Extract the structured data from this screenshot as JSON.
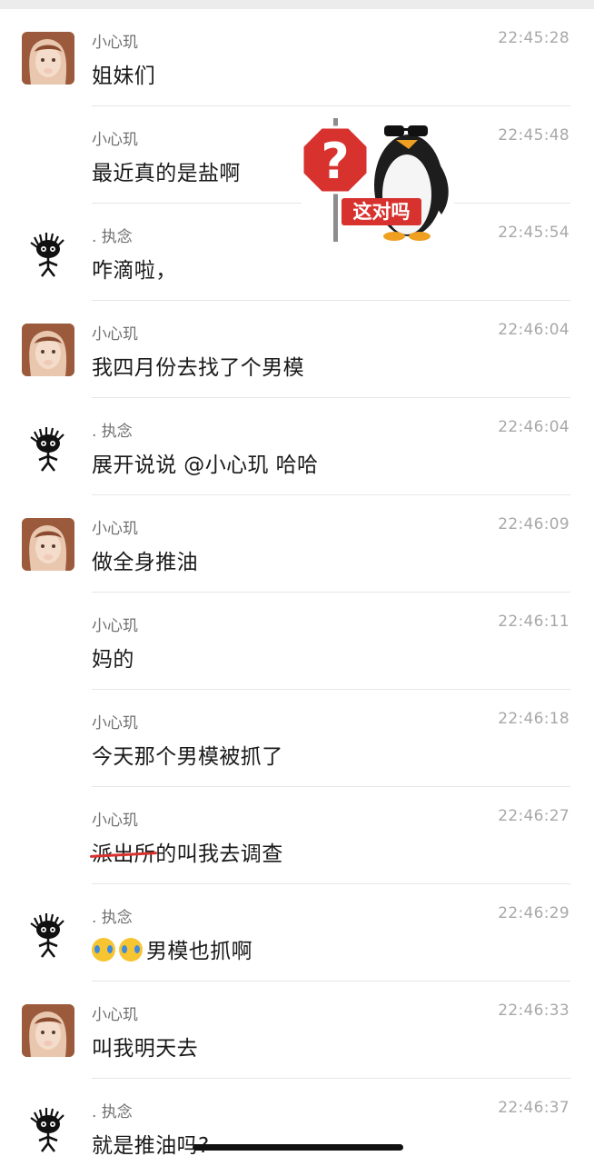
{
  "messages": [
    {
      "name": "小心玑",
      "time": "22:45:28",
      "text": "姐妹们",
      "avatar": "girl-avatar"
    },
    {
      "name": "小心玑",
      "time": "22:45:48",
      "text": "最近真的是盐啊",
      "avatar": ""
    },
    {
      "name": ". 执念",
      "time": "22:45:54",
      "text": "咋滴啦，",
      "avatar": "cartoon-avatar"
    },
    {
      "name": "小心玑",
      "time": "22:46:04",
      "text": "我四月份去找了个男模",
      "avatar": "girl-avatar"
    },
    {
      "name": ". 执念",
      "time": "22:46:04",
      "text": "展开说说 @小心玑  哈哈",
      "avatar": "cartoon-avatar"
    },
    {
      "name": "小心玑",
      "time": "22:46:09",
      "text": "做全身推油",
      "avatar": "girl-avatar"
    },
    {
      "name": "小心玑",
      "time": "22:46:11",
      "text": "妈的",
      "avatar": ""
    },
    {
      "name": "小心玑",
      "time": "22:46:18",
      "text": "今天那个男模被抓了",
      "avatar": ""
    },
    {
      "name": "小心玑",
      "time": "22:46:27",
      "text_struck": "派出所",
      "text": "的叫我去调查",
      "avatar": ""
    },
    {
      "name": ". 执念",
      "time": "22:46:29",
      "text": "男模也抓啊",
      "emoji": [
        "crying-laughing-emoji",
        "crying-laughing-emoji"
      ],
      "avatar": "cartoon-avatar"
    },
    {
      "name": "小心玑",
      "time": "22:46:33",
      "text": "叫我明天去",
      "avatar": "girl-avatar"
    },
    {
      "name": ". 执念",
      "time": "22:46:37",
      "text": "就是推油吗?",
      "avatar": "cartoon-avatar"
    }
  ],
  "sticker": {
    "sign_text": "这对吗",
    "icon": "penguin-question-sticker"
  },
  "colors": {
    "sign_red": "#d8322f",
    "time_gray": "#a8a8a8",
    "name_gray": "#6f6f6f"
  }
}
